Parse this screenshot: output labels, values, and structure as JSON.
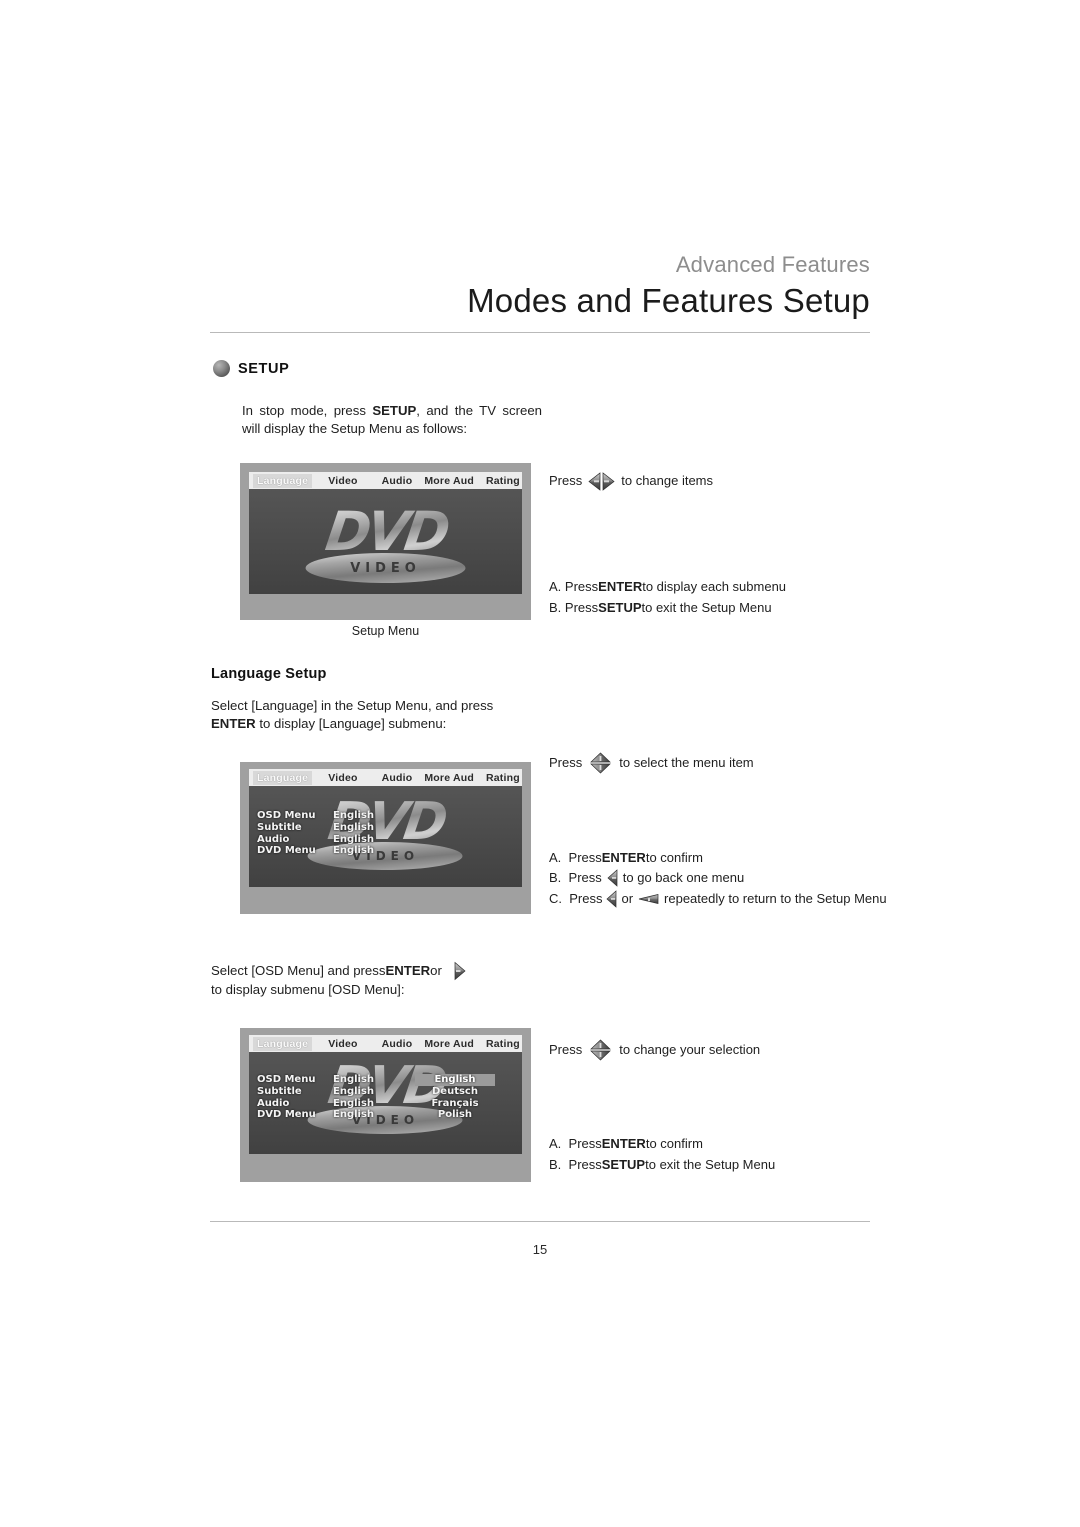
{
  "header": {
    "kicker": "Advanced Features",
    "title": "Modes and Features Setup"
  },
  "setup_section": {
    "bullet_icon": "sphere-bullet-icon",
    "label": "SETUP",
    "intro_prefix": "In stop mode, press ",
    "intro_bold": "SETUP",
    "intro_suffix": ", and the TV screen will display the Setup Menu as follows:"
  },
  "figures": {
    "setup_menu": {
      "caption": "Setup Menu",
      "menubar": [
        {
          "label": "Language",
          "selected": true
        },
        {
          "label": "Video",
          "selected": false
        },
        {
          "label": "Audio",
          "selected": false
        },
        {
          "label": "More Aud",
          "selected": false
        },
        {
          "label": "Rating",
          "selected": false
        }
      ],
      "logo_word": "DVD",
      "logo_sub": "VIDEO"
    },
    "language_submenu": {
      "menubar": [
        {
          "label": "Language",
          "selected": true
        },
        {
          "label": "Video",
          "selected": false
        },
        {
          "label": "Audio",
          "selected": false
        },
        {
          "label": "More Aud",
          "selected": false
        },
        {
          "label": "Rating",
          "selected": false
        }
      ],
      "rows": [
        {
          "label": "OSD Menu",
          "value": "English"
        },
        {
          "label": "Subtitle",
          "value": "English"
        },
        {
          "label": "Audio",
          "value": "English"
        },
        {
          "label": "DVD Menu",
          "value": "English"
        }
      ],
      "logo_word": "DVD",
      "logo_sub": "VIDEO"
    },
    "osd_submenu": {
      "menubar": [
        {
          "label": "Language",
          "selected": true
        },
        {
          "label": "Video",
          "selected": false
        },
        {
          "label": "Audio",
          "selected": false
        },
        {
          "label": "More Aud",
          "selected": false
        },
        {
          "label": "Rating",
          "selected": false
        }
      ],
      "rows": [
        {
          "label": "OSD Menu",
          "value": "English",
          "option": "English",
          "highlighted": true
        },
        {
          "label": "Subtitle",
          "value": "English",
          "option": "Deutsch",
          "highlighted": false
        },
        {
          "label": "Audio",
          "value": "English",
          "option": "Français",
          "highlighted": false
        },
        {
          "label": "DVD Menu",
          "value": "English",
          "option": "Polish",
          "highlighted": false
        }
      ],
      "logo_word": "DVD",
      "logo_sub": "VIDEO"
    }
  },
  "callouts": {
    "c1": {
      "press": "Press",
      "icon_left": "arrow-left-icon",
      "icon_right": "arrow-right-icon",
      "text": "to change items"
    },
    "c1_items": [
      {
        "marker": "A.",
        "prefix": "Press ",
        "bold": "ENTER",
        "suffix": " to display each submenu"
      },
      {
        "marker": "B.",
        "prefix": "Press ",
        "bold": "SETUP",
        "suffix": " to exit the Setup Menu"
      }
    ],
    "c2": {
      "press": "Press",
      "icon_up": "arrow-up-icon",
      "icon_down": "arrow-down-icon",
      "text": "to select the menu item"
    },
    "c2_items": [
      {
        "marker": "A.",
        "prefix": "Press ",
        "bold": "ENTER",
        "suffix": " to confirm"
      },
      {
        "marker": "B.",
        "prefix": "Press ",
        "icon": "arrow-left-icon",
        "suffix": "to go back one menu"
      },
      {
        "marker": "C.",
        "prefix": "Press ",
        "icon": "arrow-left-icon",
        "mid": "or",
        "icon2": "arrow-left-wide-icon",
        "suffix": "repeatedly to return to the Setup Menu"
      }
    ],
    "c3": {
      "press": "Press",
      "icon_up": "arrow-up-icon",
      "icon_down": "arrow-down-icon",
      "text": "to change your selection"
    },
    "c3_items": [
      {
        "marker": "A.",
        "prefix": "Press ",
        "bold": "ENTER",
        "suffix": " to confirm"
      },
      {
        "marker": "B.",
        "prefix": "Press ",
        "bold": "SETUP",
        "suffix": " to exit the Setup Menu"
      }
    ]
  },
  "language_setup": {
    "heading": "Language Setup",
    "para_prefix": "Select [Language] in the Setup Menu, and press ",
    "para_bold": "ENTER",
    "para_suffix": " to display [Language] submenu:"
  },
  "osd_setup": {
    "para_prefix": "Select [OSD Menu] and press ",
    "para_bold": "ENTER",
    "para_mid": " or",
    "para_icon": "arrow-right-icon",
    "para_suffix": "to display submenu [OSD Menu]:"
  },
  "footer": {
    "page_number": "15"
  }
}
